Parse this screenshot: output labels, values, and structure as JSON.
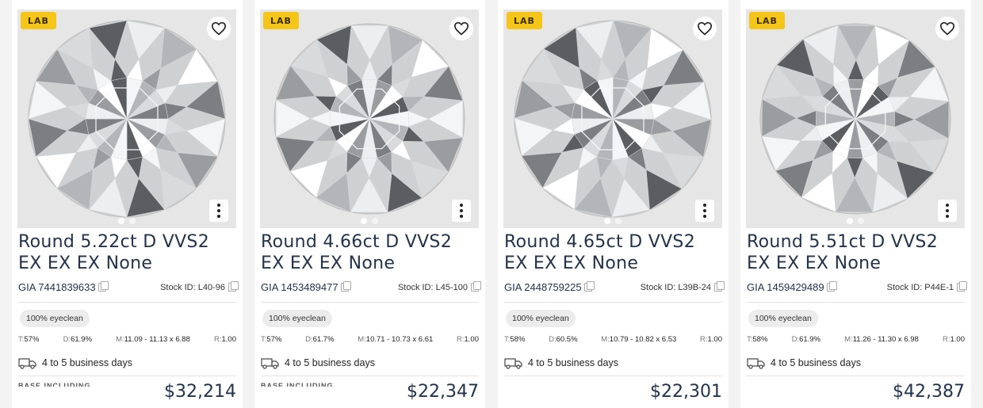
{
  "cards": [
    {
      "badge": "LAB",
      "title": "Round 5.22ct D VVS2 EX EX EX None",
      "gia": "GIA 7441839633",
      "stock": "Stock ID: L40-96",
      "eyeclean": "100% eyeclean",
      "t_key": "T:",
      "t_val": "57%",
      "d_key": "D:",
      "d_val": "61.9%",
      "m_key": "M:",
      "m_val": "11.09 - 11.13 x 6.88",
      "r_key": "R:",
      "r_val": "1.00",
      "shipping": "4 to 5 business days",
      "faded": "BASE INCLUDING",
      "price": "$32,214"
    },
    {
      "badge": "LAB",
      "title": "Round 4.66ct D VVS2 EX EX EX None",
      "gia": "GIA 1453489477",
      "stock": "Stock ID: L45-100",
      "eyeclean": "100% eyeclean",
      "t_key": "T:",
      "t_val": "57%",
      "d_key": "D:",
      "d_val": "61.7%",
      "m_key": "M:",
      "m_val": "10.71 - 10.73 x 6.61",
      "r_key": "R:",
      "r_val": "1.00",
      "shipping": "4 to 5 business days",
      "faded": "BASE INCLUDING",
      "price": "$22,347"
    },
    {
      "badge": "LAB",
      "title": "Round 4.65ct D VVS2 EX EX EX None",
      "gia": "GIA 2448759225",
      "stock": "Stock ID: L39B-24",
      "eyeclean": "100% eyeclean",
      "t_key": "T:",
      "t_val": "58%",
      "d_key": "D:",
      "d_val": "60.5%",
      "m_key": "M:",
      "m_val": "10.79 - 10.82 x 6.53",
      "r_key": "R:",
      "r_val": "1.00",
      "shipping": "4 to 5 business days",
      "faded": "",
      "price": "$22,301"
    },
    {
      "badge": "LAB",
      "title": "Round 5.51ct D VVS2 EX EX EX None",
      "gia": "GIA 1459429489",
      "stock": "Stock ID: P44E-1",
      "eyeclean": "100% eyeclean",
      "t_key": "T:",
      "t_val": "58%",
      "d_key": "D:",
      "d_val": "61.9%",
      "m_key": "M:",
      "m_val": "11.26 - 11.30 x 6.98",
      "r_key": "R:",
      "r_val": "1.00",
      "shipping": "4 to 5 business days",
      "faded": "",
      "price": "$42,387"
    }
  ],
  "icons": {
    "favorite": "heart-outline-icon",
    "more": "kebab-menu-icon",
    "copy": "copy-icon",
    "shipping": "delivery-truck-icon"
  },
  "colors": {
    "badge": "#f5c518",
    "title": "#24324a"
  }
}
